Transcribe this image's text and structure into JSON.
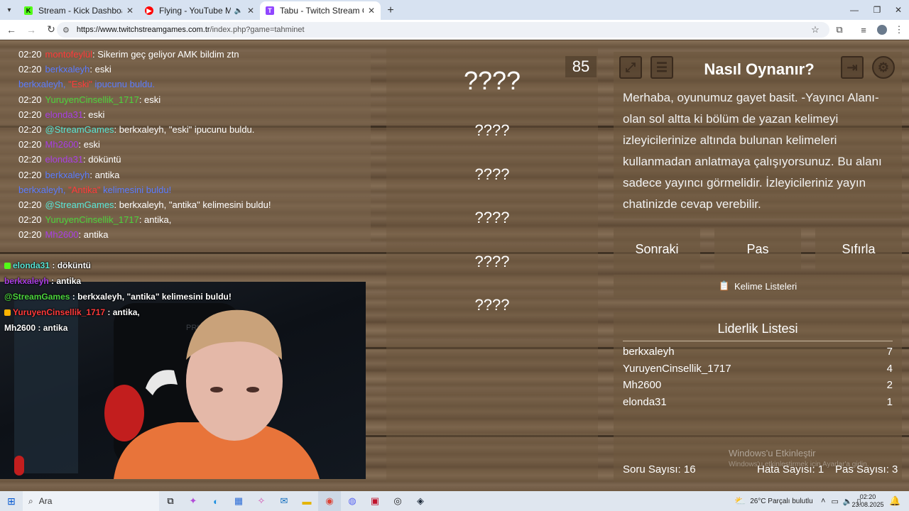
{
  "browser": {
    "tabs": [
      {
        "title": "Stream - Kick Dashboard",
        "favicon": "kick-icon",
        "color": "#53fc18",
        "glyph": "K"
      },
      {
        "title": "Flying - YouTube Music",
        "favicon": "youtube-music-icon",
        "color": "#ff0000",
        "glyph": "▶"
      },
      {
        "title": "Tabu - Twitch Stream Games",
        "favicon": "twitch-icon",
        "color": "#9146ff",
        "glyph": "T"
      }
    ],
    "url_domain": "https://www.twitchstreamgames.com.tr",
    "url_path": "/index.php?game=tahminet"
  },
  "chat": [
    {
      "time": "02:20",
      "user": "montofeylül",
      "ucolor": "red",
      "text": ": Sikerim geç geliyor AMK bildim ztn"
    },
    {
      "time": "02:20",
      "user": "berkxaleyh",
      "ucolor": "blue",
      "text": ": eski"
    },
    {
      "time": "",
      "user": "berkxaleyh, ",
      "ucolor": "blue",
      "hl": "\"Eski\"",
      "text": " ipucunu buldu.",
      "tcolor": "blue"
    },
    {
      "time": "02:20",
      "user": "YuruyenCinsellik_1717",
      "ucolor": "green",
      "text": ": eski"
    },
    {
      "time": "02:20",
      "user": "elonda31",
      "ucolor": "purple",
      "text": ": eski"
    },
    {
      "time": "02:20",
      "user": "@StreamGames",
      "ucolor": "cyan",
      "text": ": berkxaleyh, \"eski\" ipucunu buldu."
    },
    {
      "time": "02:20",
      "user": "Mh2600",
      "ucolor": "purple",
      "text": ": eski"
    },
    {
      "time": "02:20",
      "user": "elonda31",
      "ucolor": "purple",
      "text": ": döküntü"
    },
    {
      "time": "02:20",
      "user": "berkxaleyh",
      "ucolor": "blue",
      "text": ": antika"
    },
    {
      "time": "",
      "user": "berkxaleyh, ",
      "ucolor": "blue",
      "hl": "\"Antika\"",
      "text": " kelimesini buldu!",
      "tcolor": "blue"
    },
    {
      "time": "02:20",
      "user": "@StreamGames",
      "ucolor": "cyan",
      "text": ": berkxaleyh, \"antika\" kelimesini buldu!"
    },
    {
      "time": "02:20",
      "user": "YuruyenCinsellik_1717",
      "ucolor": "green",
      "text": ": antika,"
    },
    {
      "time": "02:20",
      "user": "Mh2600",
      "ucolor": "purple",
      "text": ": antika"
    }
  ],
  "overlay_chat": [
    {
      "user": "elonda31",
      "ucolor": "cyan",
      "text": " : döküntü",
      "badge": "#53fc18"
    },
    {
      "user": "berkxaleyh",
      "ucolor": "purple",
      "text": " : antika"
    },
    {
      "user": "@StreamGames",
      "ucolor": "green",
      "text": " : berkxaleyh, \"antika\" kelimesini buldu!"
    },
    {
      "user": "YuruyenCinsellik_1717",
      "ucolor": "red",
      "text": " : antika,",
      "badge": "#ffb300"
    },
    {
      "user": "Mh2600",
      "ucolor": "white",
      "text": " : antika"
    }
  ],
  "webcam": {
    "chair_text": "PRIME"
  },
  "game": {
    "timer": "85",
    "hidden_words": [
      "????",
      "????",
      "????",
      "????",
      "????",
      "????"
    ]
  },
  "howto": {
    "title": "Nasıl Oynanır?",
    "description": "Merhaba, oyunumuz gayet basit. -Yayıncı Alanı- olan sol altta ki bölüm de yazan kelimeyi izleyicilerinize altında bulunan kelimeleri kullanmadan anlatmaya çalışıyorsunuz. Bu alanı sadece yayıncı görmelidir. İzleyicileriniz yayın chatinizde cevap verebilir."
  },
  "actions": {
    "next": "Sonraki",
    "pass": "Pas",
    "reset": "Sıfırla",
    "word_lists": "Kelime Listeleri"
  },
  "leaderboard": {
    "title": "Liderlik Listesi",
    "rows": [
      {
        "name": "berkxaleyh",
        "score": "7"
      },
      {
        "name": "YuruyenCinsellik_1717",
        "score": "4"
      },
      {
        "name": "Mh2600",
        "score": "2"
      },
      {
        "name": "elonda31",
        "score": "1"
      }
    ]
  },
  "stats": {
    "questions": "Soru Sayısı: 16",
    "errors": "Hata Sayısı: 1",
    "passes": "Pas Sayısı: 3"
  },
  "watermark": {
    "line1": "Windows'u Etkinleştir",
    "line2": "Windows'u etkinleştirmek için Ayarlar'a gidin."
  },
  "taskbar": {
    "search_placeholder": "Ara",
    "weather": "26°C  Parçalı bulutlu",
    "time": "02:20",
    "date": "23.08.2025"
  },
  "colors": {
    "red": "#ff3a3a",
    "blue": "#5b7cff",
    "green": "#4cd43c",
    "purple": "#a93fe6",
    "cyan": "#58e6d6",
    "white": "#ffffff",
    "orange": "#ff8a2a"
  }
}
